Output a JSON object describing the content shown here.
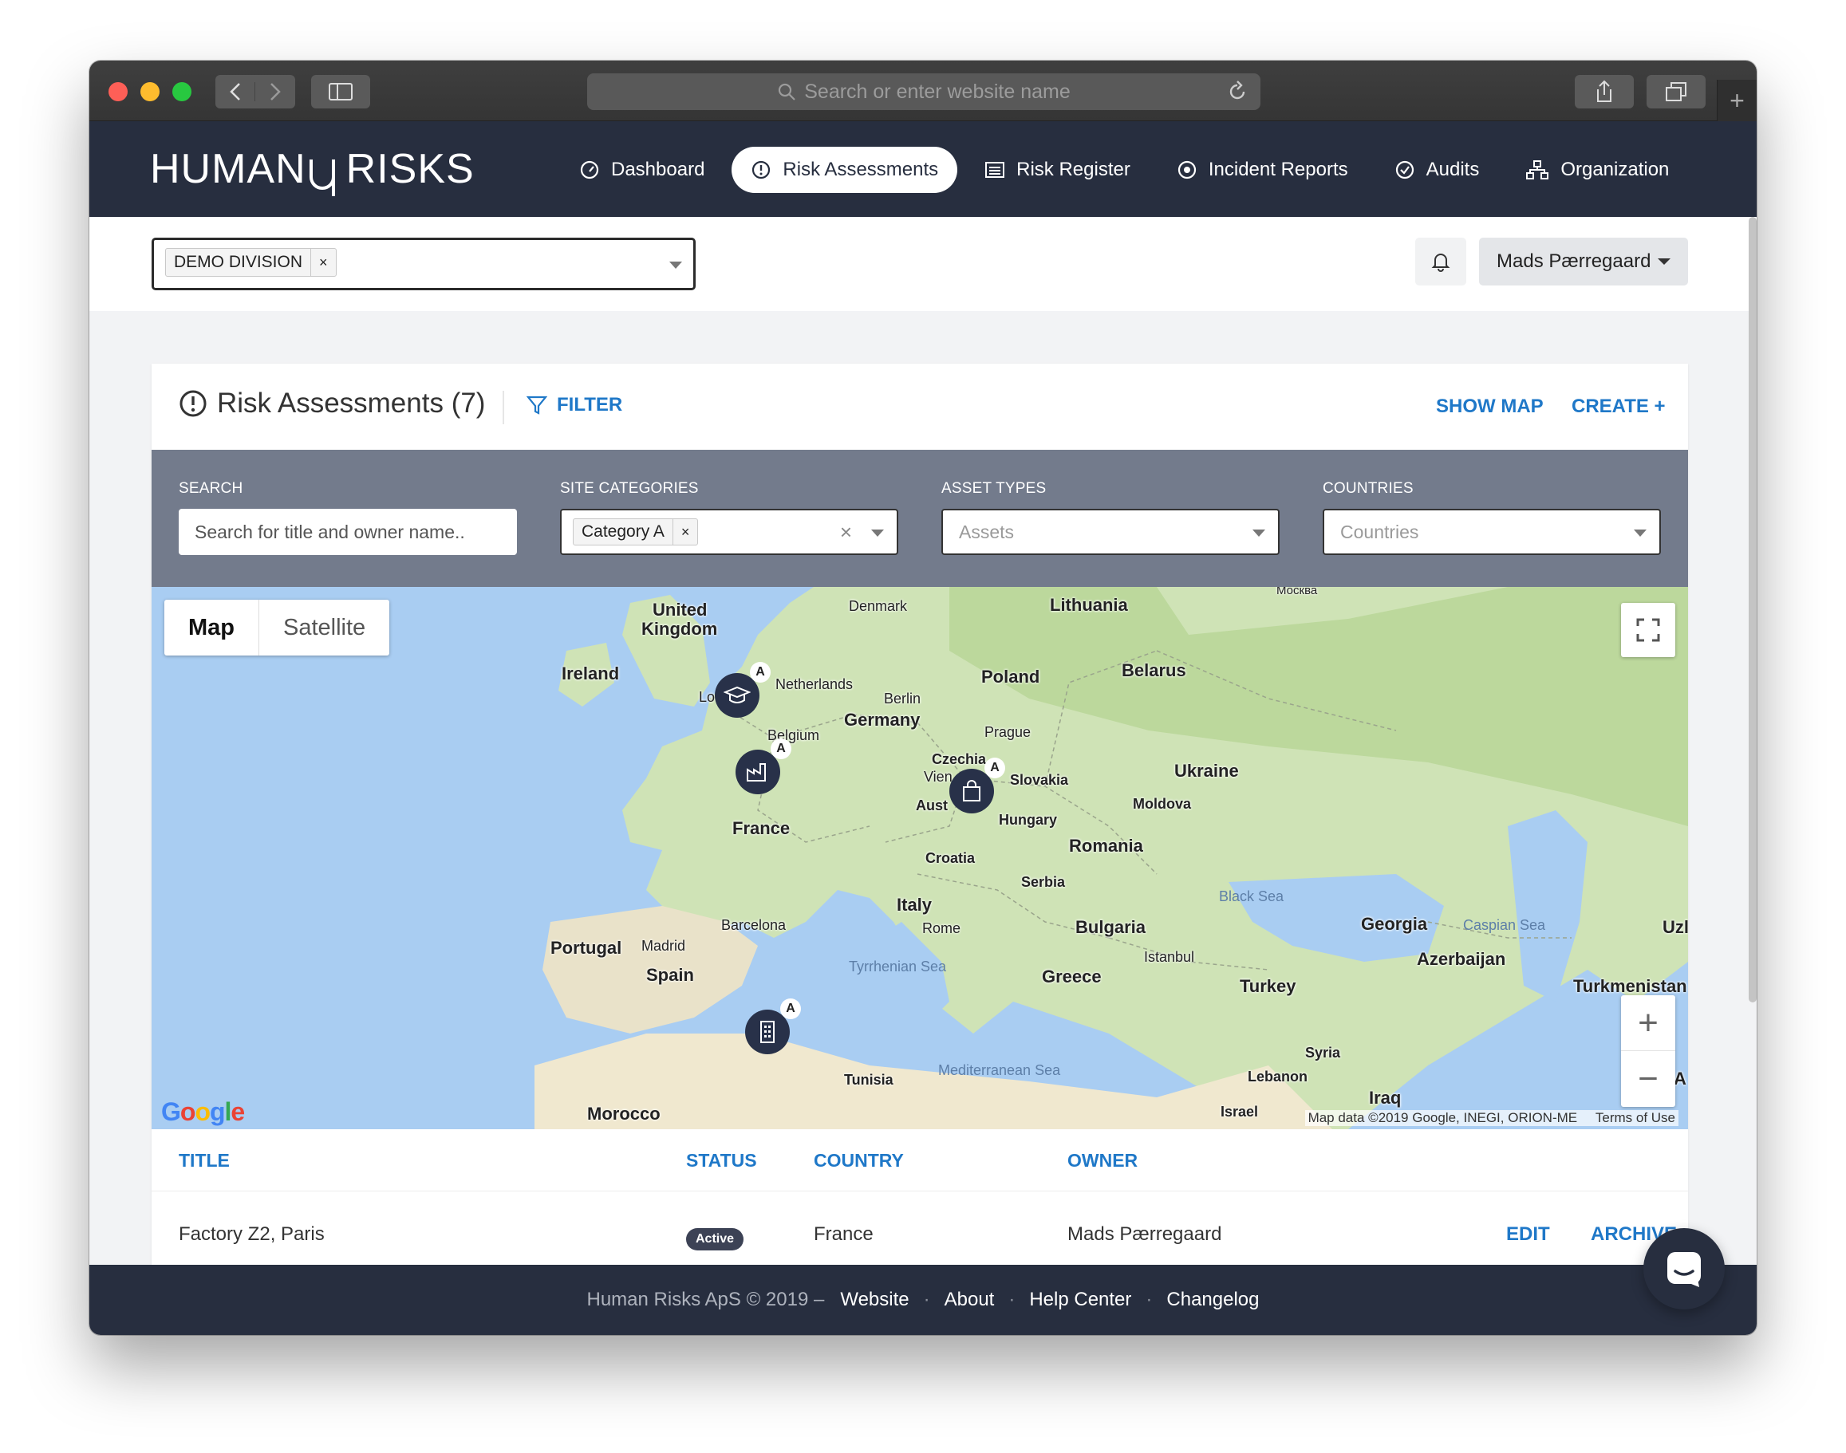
{
  "browser": {
    "url_placeholder": "Search or enter website name"
  },
  "app": {
    "logo_text_left": "HUMAN",
    "logo_text_right": "RISKS",
    "nav": [
      {
        "label": "Dashboard",
        "icon": "gauge-icon"
      },
      {
        "label": "Risk Assessments",
        "icon": "alert-circle-icon",
        "active": true
      },
      {
        "label": "Risk Register",
        "icon": "list-icon"
      },
      {
        "label": "Incident Reports",
        "icon": "target-icon"
      },
      {
        "label": "Audits",
        "icon": "check-circle-icon"
      },
      {
        "label": "Organization",
        "icon": "org-chart-icon"
      }
    ]
  },
  "subheader": {
    "division_tag": "DEMO DIVISION",
    "tag_remove": "×",
    "user_name": "Mads Pærregaard"
  },
  "card": {
    "title": "Risk Assessments (7)",
    "filter_label": "FILTER",
    "show_map_label": "SHOW MAP",
    "create_label": "CREATE +"
  },
  "filters": {
    "search": {
      "label": "SEARCH",
      "placeholder": "Search for title and owner name.."
    },
    "site_categories": {
      "label": "SITE CATEGORIES",
      "tag": "Category A",
      "tag_remove": "×",
      "clear": "×"
    },
    "asset_types": {
      "label": "ASSET TYPES",
      "placeholder": "Assets"
    },
    "countries": {
      "label": "COUNTRIES",
      "placeholder": "Countries"
    }
  },
  "map": {
    "type_map": "Map",
    "type_satellite": "Satellite",
    "zoom_in": "+",
    "zoom_out": "−",
    "google_logo": "Google",
    "attribution": "Map data ©2019 Google, INEGI, ORION-ME",
    "terms": "Terms of Use",
    "marker_badge": "A",
    "labels": {
      "united_kingdom_1": "United",
      "united_kingdom_2": "Kingdom",
      "ireland": "Ireland",
      "denmark": "Denmark",
      "lithuania": "Lithuania",
      "moscow": "Москва",
      "netherlands": "Netherlands",
      "berlin": "Berlin",
      "poland": "Poland",
      "belarus": "Belarus",
      "germany": "Germany",
      "belgium": "Belgium",
      "prague": "Prague",
      "czechia": "Czechia",
      "vienna": "Vien",
      "slovakia": "Slovakia",
      "ukraine": "Ukraine",
      "london": "Lo",
      "austria": "Aust",
      "moldova": "Moldova",
      "hungary": "Hungary",
      "france": "France",
      "romania": "Romania",
      "croatia": "Croatia",
      "serbia": "Serbia",
      "italy": "Italy",
      "black_sea": "Black Sea",
      "rome": "Rome",
      "barcelona": "Barcelona",
      "bulgaria": "Bulgaria",
      "georgia": "Georgia",
      "caspian_sea": "Caspian Sea",
      "uz": "Uzl",
      "portugal": "Portugal",
      "madrid": "Madrid",
      "spain": "Spain",
      "istanbul": "Istanbul",
      "azerbaijan": "Azerbaijan",
      "tyrrhenian_sea": "Tyrrhenian Sea",
      "greece": "Greece",
      "turkey": "Turkey",
      "turkmenistan": "Turkmenistan",
      "syria": "Syria",
      "tunisia": "Tunisia",
      "mediterranean_sea": "Mediterranean Sea",
      "lebanon": "Lebanon",
      "iraq": "Iraq",
      "morocco": "Morocco",
      "israel": "Israel",
      "a_edge": "A"
    }
  },
  "table": {
    "headers": {
      "title": "TITLE",
      "status": "STATUS",
      "country": "COUNTRY",
      "owner": "OWNER"
    },
    "rows": [
      {
        "title": "Factory Z2, Paris",
        "status": "Active",
        "country": "France",
        "owner": "Mads Pærregaard",
        "edit": "EDIT",
        "archive": "ARCHIVE"
      }
    ]
  },
  "footer": {
    "copyright": "Human Risks ApS © 2019 –",
    "links": [
      "Website",
      "About",
      "Help Center",
      "Changelog"
    ],
    "separator": "·"
  },
  "colors": {
    "header_bg": "#272e3f",
    "accent": "#1f78c8",
    "filter_bar_bg": "#737b8c"
  }
}
